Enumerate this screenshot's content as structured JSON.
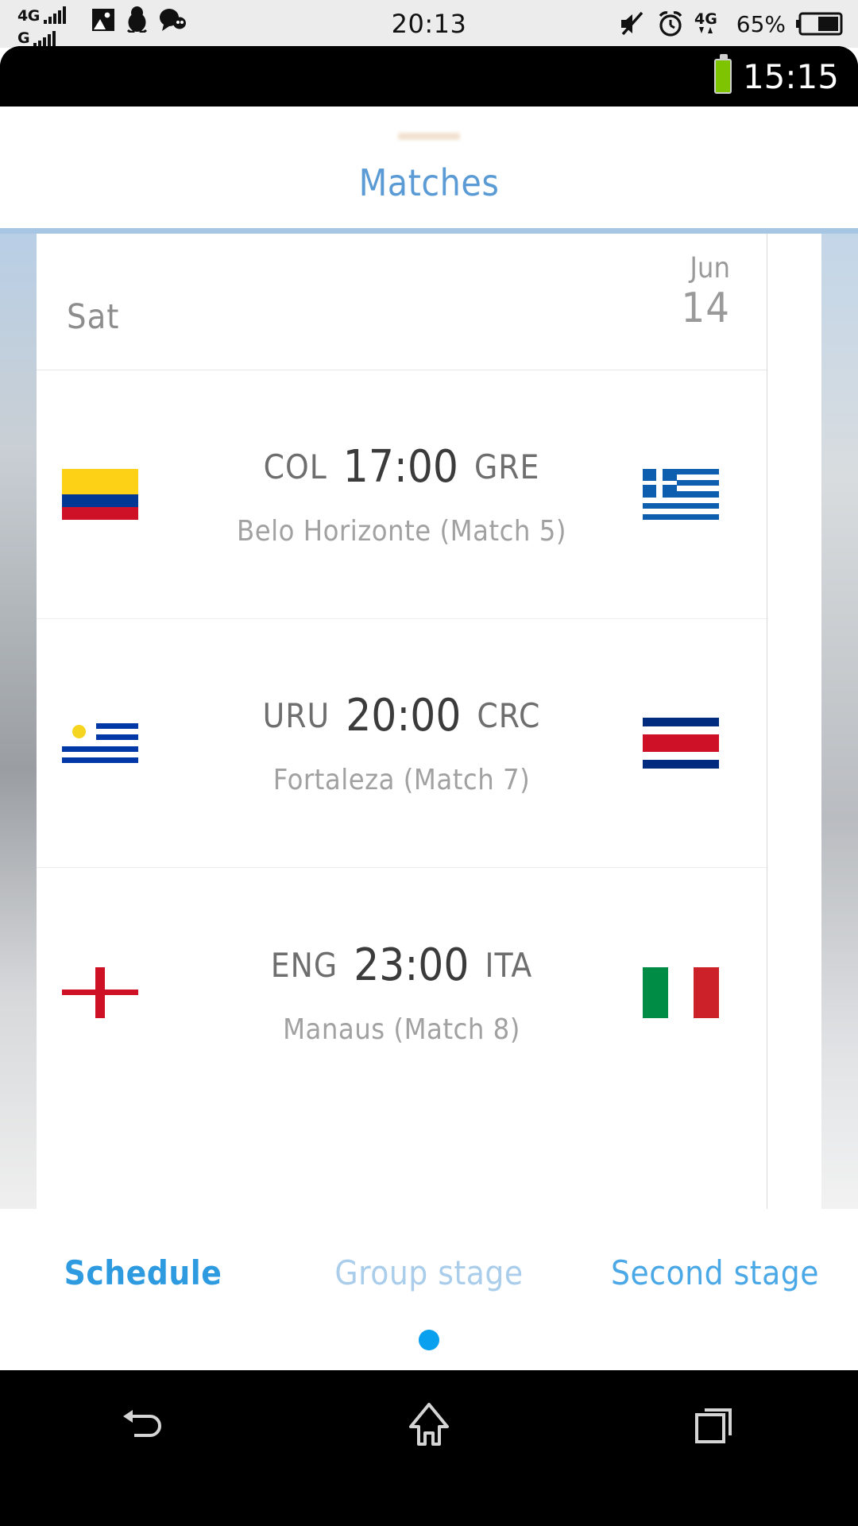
{
  "host_status_bar": {
    "network_primary": "4G",
    "network_secondary": "G",
    "clock": "20:13",
    "battery_percent": "65%",
    "icons": [
      "photo-icon",
      "penguin-icon",
      "chat-bubbles-icon",
      "mute-icon",
      "alarm-clock-icon",
      "data-transfer-4g-icon",
      "battery-icon"
    ]
  },
  "device_status_bar": {
    "clock": "15:15",
    "battery_icon": "battery-charged-icon"
  },
  "app": {
    "title": "Matches"
  },
  "schedule": {
    "date_header": {
      "day_of_week": "Sat",
      "month": "Jun",
      "day": "14"
    },
    "matches": [
      {
        "home_code": "COL",
        "home_flag": "colombia-flag",
        "time": "17:00",
        "away_code": "GRE",
        "away_flag": "greece-flag",
        "venue": "Belo Horizonte (Match  5)"
      },
      {
        "home_code": "URU",
        "home_flag": "uruguay-flag",
        "time": "20:00",
        "away_code": "CRC",
        "away_flag": "costa-rica-flag",
        "venue": "Fortaleza (Match  7)"
      },
      {
        "home_code": "ENG",
        "home_flag": "england-flag",
        "time": "23:00",
        "away_code": "ITA",
        "away_flag": "italy-flag",
        "venue": "Manaus (Match  8)"
      }
    ]
  },
  "tabs": [
    {
      "label": "Schedule",
      "state": "active"
    },
    {
      "label": "Group stage",
      "state": "dim"
    },
    {
      "label": "Second stage",
      "state": "alt"
    }
  ],
  "nav_bar": {
    "back": "back-icon",
    "home": "home-icon",
    "recents": "recents-icon"
  },
  "colors": {
    "accent_blue": "#2e9ae0",
    "title_blue": "#5b9bd5",
    "border_blue": "#a6c6e3",
    "dot_blue": "#09a0f0",
    "battery_green": "#7ec400"
  }
}
